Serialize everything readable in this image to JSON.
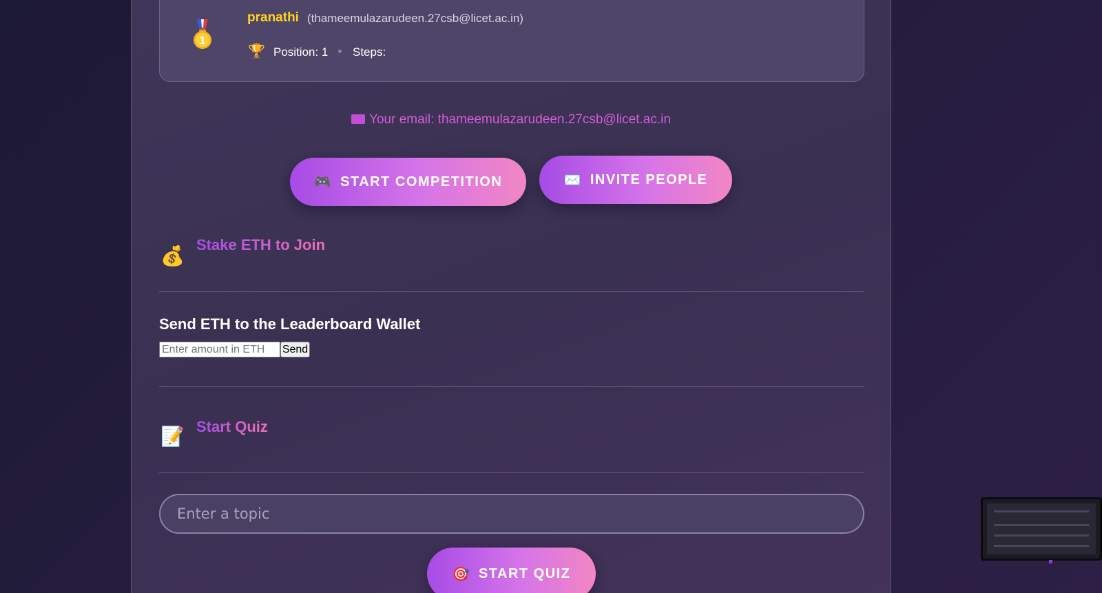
{
  "leaderboard": {
    "entries": [
      {
        "rank_icon": "gold-medal-icon",
        "name": "pranathi",
        "email": "(thameemulazarudeen.27csb@licet.ac.in)",
        "position_label": "Position: 1",
        "steps_label": "Steps:"
      }
    ]
  },
  "your_email": {
    "label": "Your email: thameemulazarudeen.27csb@licet.ac.in"
  },
  "actions": {
    "start_competition": "START COMPETITION",
    "invite_people": "INVITE PEOPLE"
  },
  "stake": {
    "icon": "money-bag-icon",
    "title": "Stake ETH to Join"
  },
  "send": {
    "title": "Send ETH to the Leaderboard Wallet",
    "amount_placeholder": "Enter amount in ETH",
    "amount_value": "",
    "button": "Send"
  },
  "quiz": {
    "icon": "memo-icon",
    "title": "Start Quiz",
    "topic_placeholder": "Enter a topic",
    "topic_value": "",
    "button": "START QUIZ"
  },
  "colors": {
    "accent_purple": "#a64be6",
    "accent_pink": "#f286c4",
    "gold": "#ffd21f",
    "email_pink": "#d65ad9"
  }
}
